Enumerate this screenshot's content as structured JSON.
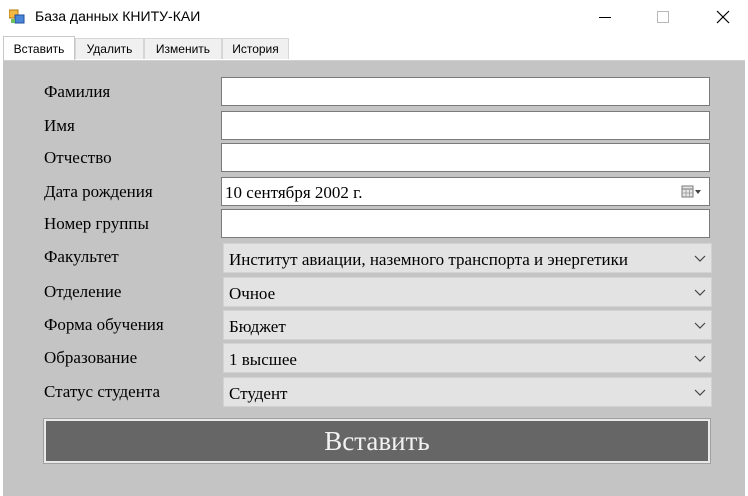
{
  "window": {
    "title": "База данных КНИТУ-КАИ"
  },
  "tabs": [
    {
      "label": "Вставить",
      "active": true
    },
    {
      "label": "Удалить",
      "active": false
    },
    {
      "label": "Изменить",
      "active": false
    },
    {
      "label": "История",
      "active": false
    }
  ],
  "form": {
    "surname_label": "Фамилия",
    "surname_value": "",
    "name_label": "Имя",
    "name_value": "",
    "patronymic_label": "Отчество",
    "patronymic_value": "",
    "birthdate_label": "Дата рождения",
    "birthdate_value": "10 сентября 2002 г.",
    "group_label": "Номер группы",
    "group_value": "",
    "faculty_label": "Факультет",
    "faculty_value": "Институт авиации, наземного транспорта и энергетики",
    "department_label": "Отделение",
    "department_value": "Очное",
    "study_form_label": "Форма обучения",
    "study_form_value": "Бюджет",
    "education_label": "Образование",
    "education_value": "1 высшее",
    "status_label": "Статус студента",
    "status_value": "Студент"
  },
  "actions": {
    "insert_label": "Вставить"
  },
  "icons": {
    "app": "database-app-icon",
    "minimize": "minimize-icon",
    "maximize": "maximize-icon",
    "close": "close-icon",
    "calendar": "calendar-icon",
    "dropdown": "chevron-down-icon"
  },
  "colors": {
    "panel_background": "#c4c4c4",
    "button_background": "#666666",
    "combo_background": "#e3e3e3"
  }
}
